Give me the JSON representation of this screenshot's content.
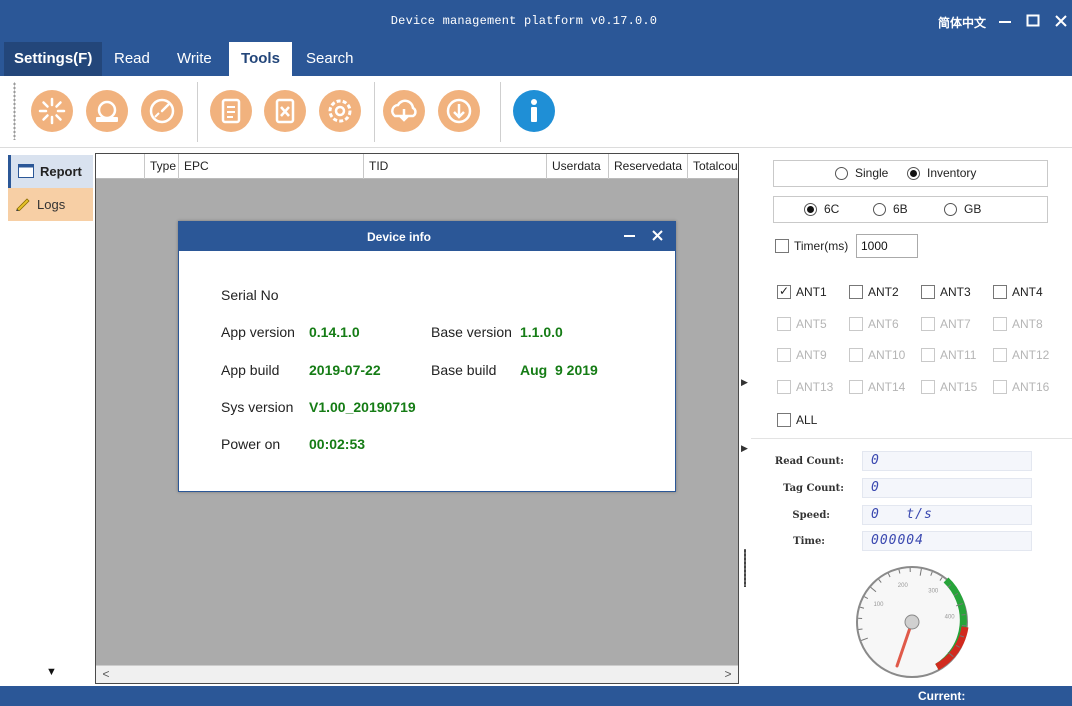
{
  "window": {
    "title": "Device management platform v0.17.0.0",
    "language": "简体中文"
  },
  "menu": {
    "settings": "Settings(F)",
    "read": "Read",
    "write": "Write",
    "tools": "Tools",
    "search": "Search"
  },
  "toolbar": {
    "icons": [
      "burst-icon",
      "disconnect-icon",
      "gauge-icon",
      "document-icon",
      "close-file-icon",
      "gear-icon",
      "cloud-upload-icon",
      "download-icon",
      "info-icon"
    ],
    "accent_color": "#f1b27e",
    "info_color": "#1f8fd6"
  },
  "sidebar": {
    "report": "Report",
    "logs": "Logs"
  },
  "table": {
    "columns": [
      "Type",
      "EPC",
      "TID",
      "Userdata",
      "Reservedata",
      "Totalcou"
    ]
  },
  "dialog": {
    "title": "Device info",
    "serial_label": "Serial No",
    "app_version_label": "App version",
    "app_version": "0.14.1.0",
    "base_version_label": "Base version",
    "base_version": "1.1.0.0",
    "app_build_label": "App build",
    "app_build": "2019-07-22",
    "base_build_label": "Base build",
    "base_build": "Aug  9 2019",
    "sys_version_label": "Sys version",
    "sys_version": "V1.00_20190719",
    "power_on_label": "Power on",
    "power_on": "00:02:53"
  },
  "panel": {
    "mode_single": "Single",
    "mode_inventory": "Inventory",
    "mode_selected": "Inventory",
    "proto_6c": "6C",
    "proto_6b": "6B",
    "proto_gb": "GB",
    "proto_selected": "6C",
    "timer_label": "Timer(ms)",
    "timer_value": "1000",
    "antennas": [
      "ANT1",
      "ANT2",
      "ANT3",
      "ANT4",
      "ANT5",
      "ANT6",
      "ANT7",
      "ANT8",
      "ANT9",
      "ANT10",
      "ANT11",
      "ANT12",
      "ANT13",
      "ANT14",
      "ANT15",
      "ANT16"
    ],
    "ant_checked": [
      "ANT1"
    ],
    "all_label": "ALL"
  },
  "stats": {
    "read_count_label": "Read Count:",
    "read_count": "0",
    "tag_count_label": "Tag Count:",
    "tag_count": "0",
    "speed_label": "Speed:",
    "speed": "0   t/s",
    "time_label": "Time:",
    "time": "000004"
  },
  "gauge": {
    "labels": [
      "100",
      "200",
      "300",
      "400"
    ],
    "value": 0,
    "min": 0,
    "max": 500
  },
  "status": {
    "current_label": "Current:"
  }
}
